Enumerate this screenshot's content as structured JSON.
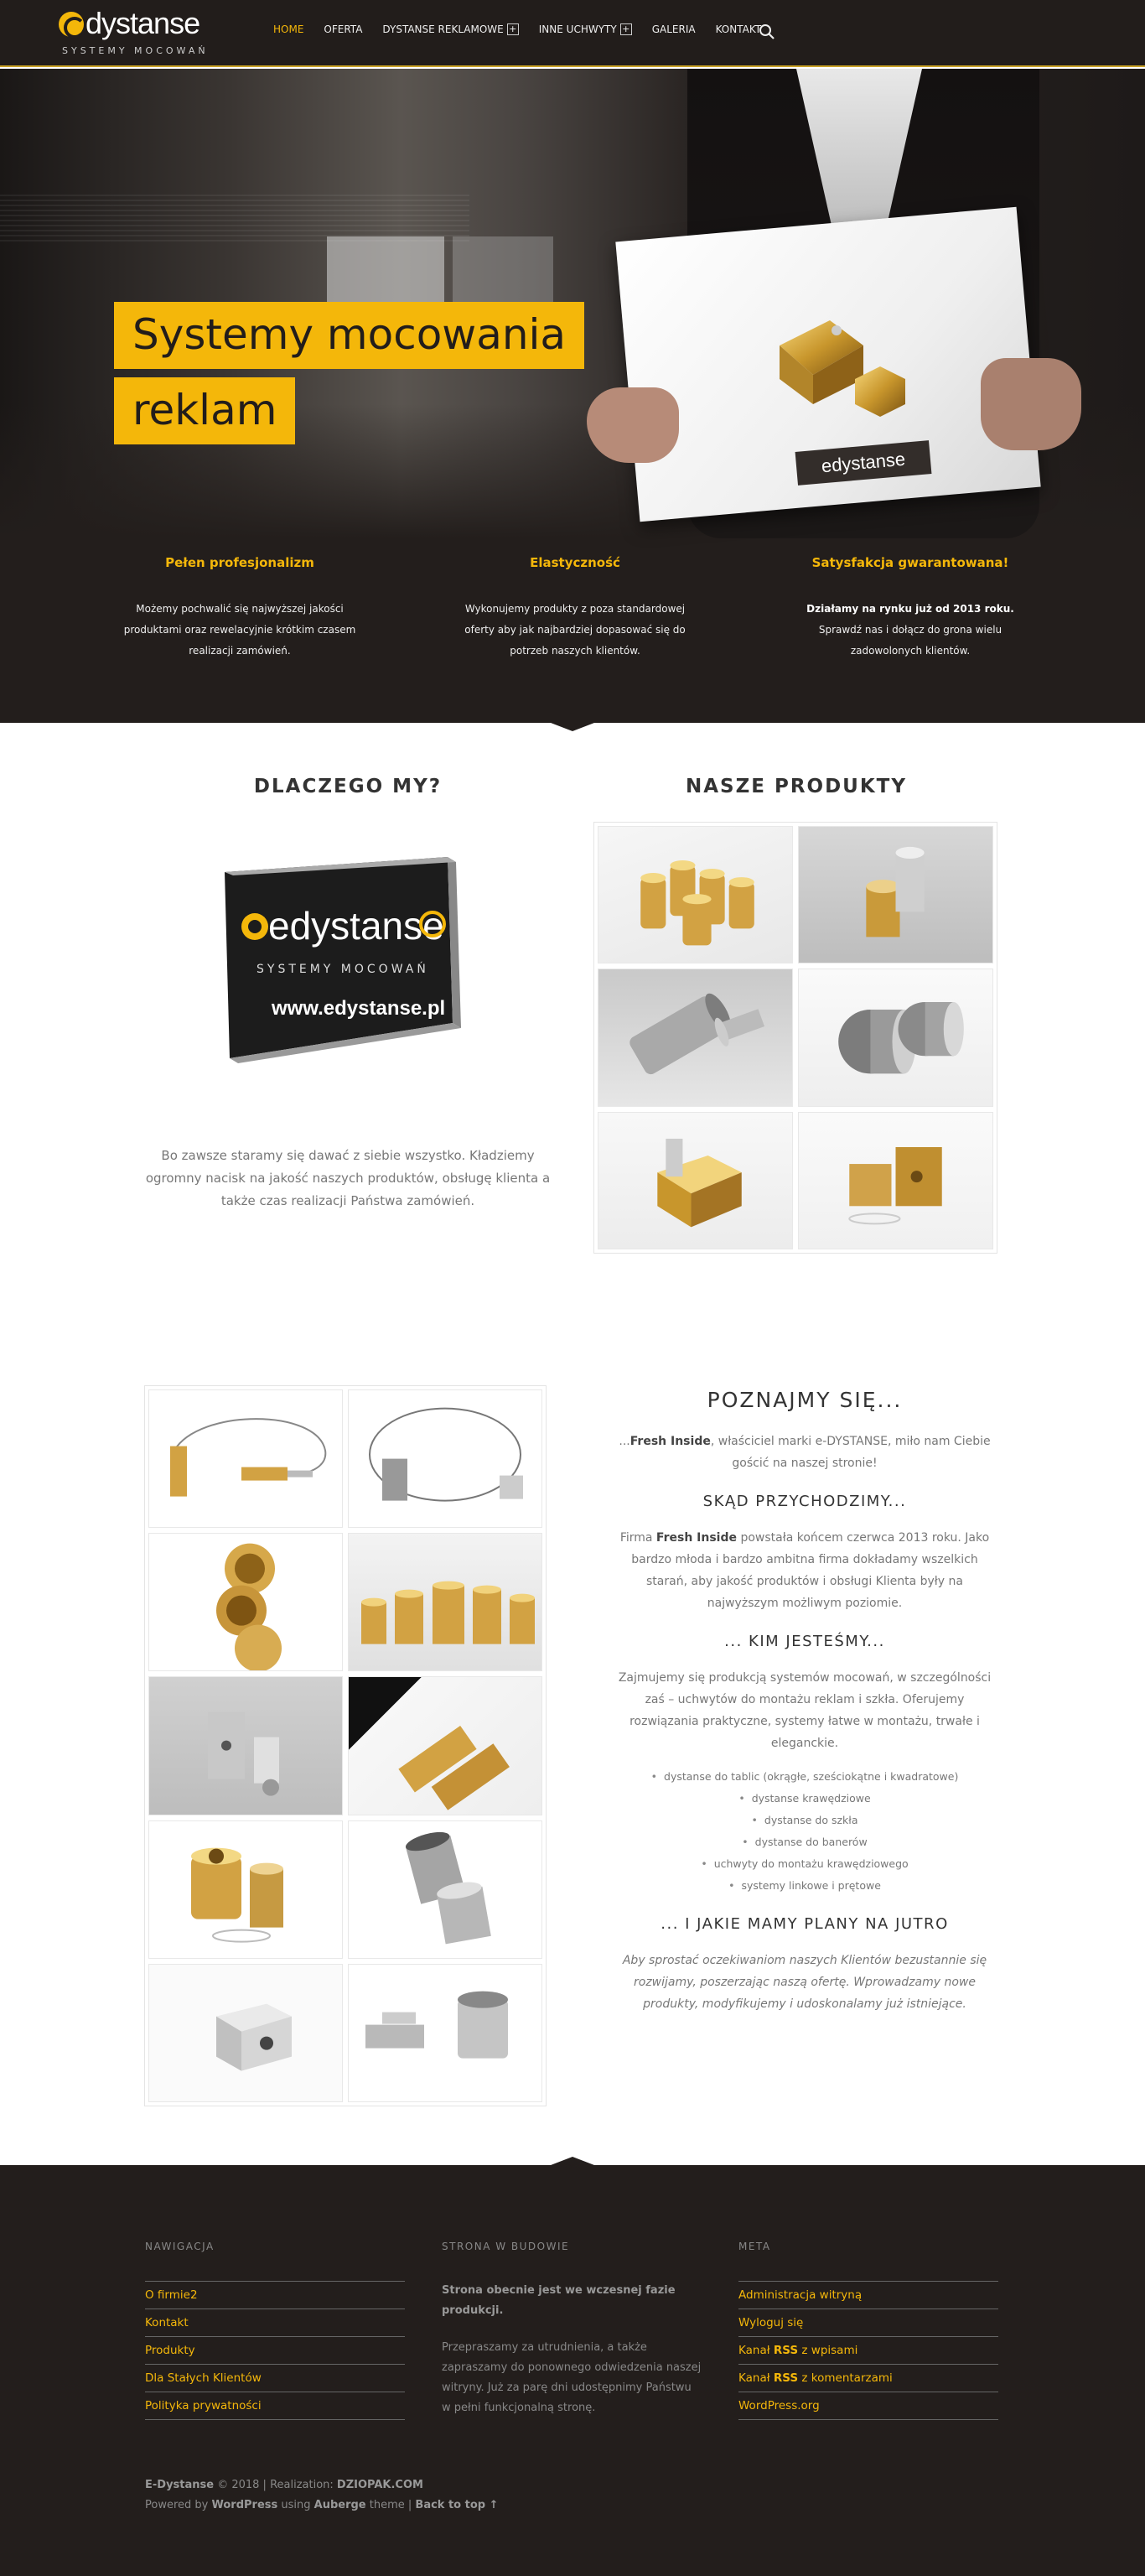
{
  "header": {
    "logo_text": "dystanse",
    "logo_sub": "SYSTEMY MOCOWAŃ",
    "nav": [
      {
        "label": "HOME",
        "active": true
      },
      {
        "label": "OFERTA"
      },
      {
        "label": "DYSTANSE REKLAMOWE",
        "plus": "+"
      },
      {
        "label": "INNE UCHWYTY",
        "plus": "+"
      },
      {
        "label": "GALERIA"
      },
      {
        "label": "KONTAKT"
      }
    ]
  },
  "hero": {
    "title_line1": "Systemy mocowania",
    "title_line2": "reklam",
    "board_logo": "edystanse",
    "features": [
      {
        "title": "Pełen profesjonalizm",
        "text": "Możemy pochwalić się najwyższej jakości produktami oraz rewelacyjnie krótkim czasem realizacji zamówień."
      },
      {
        "title": "Elastyczność",
        "text": "Wykonujemy produkty z poza standardowej oferty aby jak najbardziej dopasować się do potrzeb naszych klientów."
      },
      {
        "title": "Satysfakcja gwarantowana!",
        "bold": "Działamy na rynku już od 2013 roku.",
        "text": "Sprawdź nas i dołącz do grona wielu zadowolonych klientów."
      }
    ]
  },
  "why": {
    "heading": "DLACZEGO MY?",
    "sign_logo": "edystanse",
    "sign_sub": "SYSTEMY MOCOWAŃ",
    "sign_url": "www.edystanse.pl",
    "text": "Bo zawsze staramy się dawać z siebie wszystko. Kładziemy ogromny nacisk na jakość naszych produktów, obsługę klienta a także czas realizacji Państwa zamówień."
  },
  "products": {
    "heading": "NASZE PRODUKTY"
  },
  "about": {
    "heading": "POZNAJMY SIĘ...",
    "intro_pre": "...",
    "intro_bold": "Fresh Inside",
    "intro_rest": ", właściciel marki e-DYSTANSE, miło nam Ciebie gościć na naszej stronie!",
    "h_origin": "SKĄD PRZYCHODZIMY...",
    "origin_pre": "Firma ",
    "origin_bold": "Fresh Inside",
    "origin_rest": " powstała końcem czerwca 2013 roku. Jako bardzo młoda i bardzo ambitna firma dokładamy wszelkich starań, aby jakość produktów i obsługi Klienta były na najwyższym możliwym poziomie.",
    "h_who": "... KIM JESTEŚMY...",
    "who_text": "Zajmujemy się produkcją systemów mocowań, w szczególności zaś – uchwytów do montażu reklam i szkła. Oferujemy rozwiązania praktyczne, systemy łatwe w montażu, trwałe i eleganckie.",
    "list": [
      "dystanse do tablic (okrągłe, sześciokątne i kwadratowe)",
      "dystanse krawędziowe",
      "dystanse do szkła",
      "dystanse do banerów",
      "uchwyty do montażu krawędziowego",
      "systemy linkowe i prętowe"
    ],
    "h_plans": "... I JAKIE MAMY PLANY NA JUTRO",
    "plans_text": "Aby sprostać oczekiwaniom naszych Klientów bezustannie się rozwijamy, poszerzając naszą ofertę. Wprowadzamy nowe produkty, modyfikujemy i udoskonalamy już istniejące."
  },
  "footer": {
    "nav_title": "NAWIGACJA",
    "nav_links": [
      "O firmie2",
      "Kontakt",
      "Produkty",
      "Dla Stałych Klientów",
      "Polityka prywatności"
    ],
    "build_title": "STRONA W BUDOWIE",
    "build_bold": "Strona obecnie jest we wczesnej fazie produkcji.",
    "build_text": "Przepraszamy za utrudnienia, a także zapraszamy do ponownego odwiedzenia naszej witryny. Już za parę dni udostępnimy Państwu w pełni funkcjonalną stronę.",
    "meta_title": "META",
    "meta_admin": "Administracja witryną",
    "meta_logout": "Wyloguj się",
    "meta_rss1_a": "Kanał ",
    "meta_rss1_b": "RSS",
    "meta_rss1_c": " z wpisami",
    "meta_rss2_a": "Kanał ",
    "meta_rss2_b": "RSS",
    "meta_rss2_c": " z komentarzami",
    "meta_wp": "WordPress.org",
    "copy1_bold": "E-Dystanse",
    "copy1_mid": " © 2018 | Realization: ",
    "copy1_bold2": "DZIOPAK.COM",
    "copy2_a": "Powered by ",
    "copy2_b": "WordPress",
    "copy2_c": " using ",
    "copy2_d": "Auberge",
    "copy2_e": " theme | ",
    "copy2_f": "Back to top ↑"
  },
  "colors": {
    "accent": "#f4b70a",
    "dark": "#231e1c"
  }
}
